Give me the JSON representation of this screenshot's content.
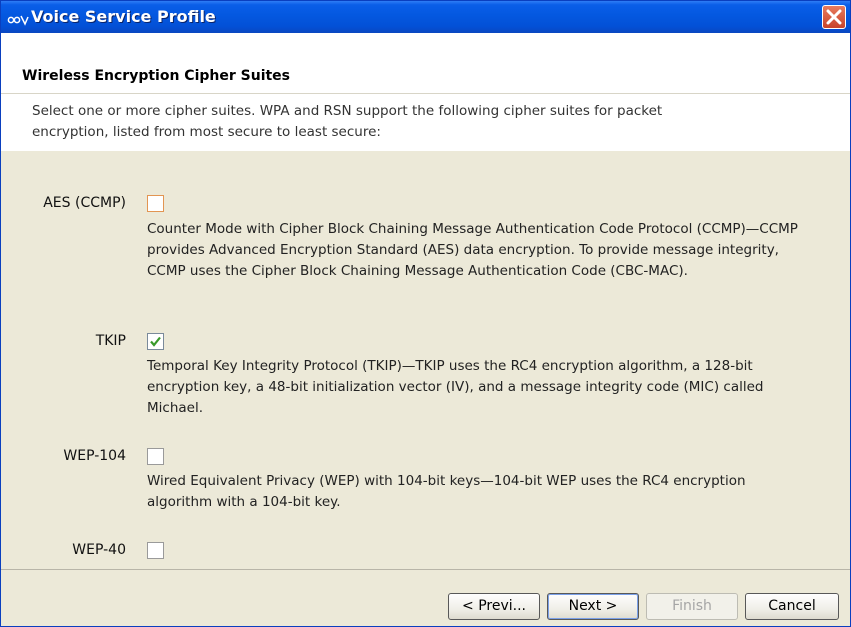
{
  "window": {
    "title": "Voice Service Profile",
    "app_icon": "app-logo-icon",
    "close_icon": "close-icon"
  },
  "header": {
    "title": "Wireless Encryption Cipher Suites",
    "description": "Select one or more cipher suites. WPA and RSN support the following cipher suites for packet encryption, listed from most secure to least secure:"
  },
  "ciphers": [
    {
      "label": "AES (CCMP)",
      "checked": false,
      "description": "Counter Mode with Cipher Block Chaining Message Authentication Code Protocol (CCMP)—CCMP provides Advanced Encryption Standard (AES) data encryption. To provide message  integrity, CCMP uses the Cipher Block Chaining Message Authentication Code (CBC-MAC)."
    },
    {
      "label": "TKIP",
      "checked": true,
      "description": "Temporal Key Integrity Protocol (TKIP)—TKIP uses the RC4 encryption algorithm, a 128-bit encryption key, a 48-bit initialization vector (IV), and a message integrity code (MIC) called Michael."
    },
    {
      "label": "WEP-104",
      "checked": false,
      "description": "Wired Equivalent Privacy (WEP) with 104-bit keys—104-bit WEP uses the RC4 encryption algorithm with a 104-bit key."
    },
    {
      "label": "WEP-40",
      "checked": false
    }
  ],
  "buttons": {
    "previous": "< Previ...",
    "next": "Next >",
    "finish": "Finish",
    "cancel": "Cancel"
  },
  "colors": {
    "titlebar": "#0458e0",
    "checkmark": "#3a9a2a",
    "focus_checkbox_border": "#e29552"
  }
}
